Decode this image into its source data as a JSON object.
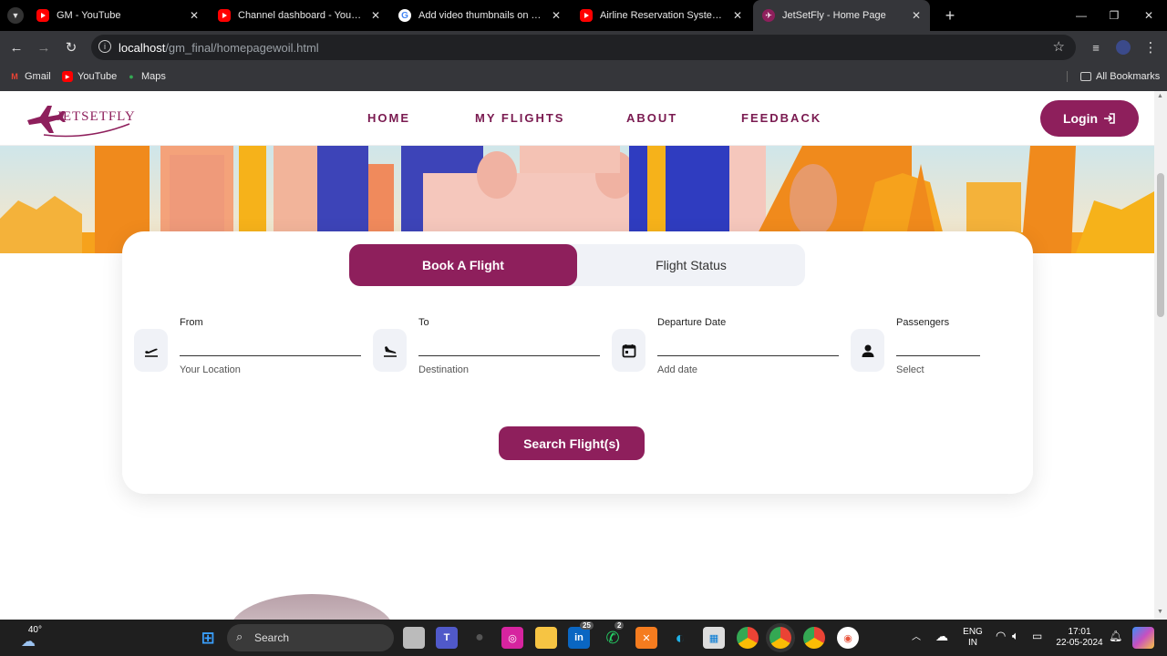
{
  "browser": {
    "tabs": [
      {
        "title": "GM - YouTube",
        "favicon": "youtube"
      },
      {
        "title": "Channel dashboard - YouTube S",
        "favicon": "youtube"
      },
      {
        "title": "Add video thumbnails on YouTu",
        "favicon": "google"
      },
      {
        "title": "Airline Reservation System Proje",
        "favicon": "youtube"
      },
      {
        "title": "JetSetFly - Home Page",
        "favicon": "jetsetfly"
      }
    ],
    "url_host": "localhost",
    "url_path": "/gm_final/homepagewoil.html",
    "bookmarks": [
      "Gmail",
      "YouTube",
      "Maps"
    ],
    "all_bookmarks": "All Bookmarks"
  },
  "site": {
    "logo_text": "JETSETFLY",
    "nav": [
      "HOME",
      "MY FLIGHTS",
      "ABOUT",
      "FEEDBACK"
    ],
    "login_label": "Login",
    "brand_color": "#8e1f5c"
  },
  "booking": {
    "tabs": [
      "Book A Flight",
      "Flight Status"
    ],
    "active_tab": "Book A Flight",
    "fields": [
      {
        "label": "From",
        "placeholder": "Your Location",
        "icon": "plane-departure-icon"
      },
      {
        "label": "To",
        "placeholder": "Destination",
        "icon": "plane-arrival-icon"
      },
      {
        "label": "Departure Date",
        "placeholder": "Add date",
        "icon": "calendar-icon"
      },
      {
        "label": "Passengers",
        "placeholder": "Select",
        "icon": "person-icon"
      }
    ],
    "search_label": "Search Flight(s)"
  },
  "taskbar": {
    "weather": "40°",
    "search_label": "Search",
    "badges": {
      "linkedin": "25",
      "whatsapp": "2"
    },
    "language": "ENG",
    "region": "IN",
    "time": "17:01",
    "date": "22-05-2024"
  }
}
